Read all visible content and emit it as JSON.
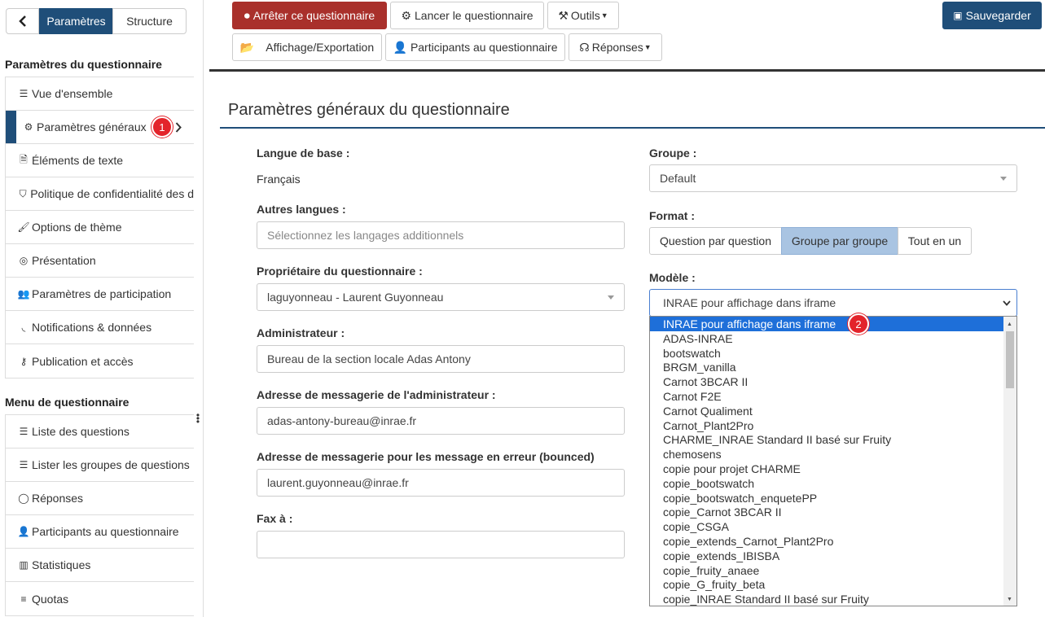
{
  "sidebar": {
    "tabs": {
      "params": "Paramètres",
      "structure": "Structure"
    },
    "section1_title": "Paramètres du questionnaire",
    "section1_items": [
      {
        "icon": "list-icon",
        "label": "Vue d'ensemble"
      },
      {
        "icon": "gears-icon",
        "label": "Paramètres généraux",
        "badge": "1"
      },
      {
        "icon": "file-text-icon",
        "label": "Éléments de texte"
      },
      {
        "icon": "shield-icon",
        "label": "Politique de confidentialité des d"
      },
      {
        "icon": "brush-icon",
        "label": "Options de thème"
      },
      {
        "icon": "eye-slash-icon",
        "label": "Présentation"
      },
      {
        "icon": "users-icon",
        "label": "Paramètres de participation"
      },
      {
        "icon": "rss-icon",
        "label": "Notifications & données"
      },
      {
        "icon": "key-icon",
        "label": "Publication et accès"
      }
    ],
    "section2_title": "Menu de questionnaire",
    "section2_items": [
      {
        "icon": "list-icon",
        "label": "Liste des questions"
      },
      {
        "icon": "list-icon",
        "label": "Lister les groupes de questions"
      },
      {
        "icon": "comment-icon",
        "label": "Réponses"
      },
      {
        "icon": "user-icon",
        "label": "Participants au questionnaire"
      },
      {
        "icon": "bar-chart-icon",
        "label": "Statistiques"
      },
      {
        "icon": "bars-icon",
        "label": "Quotas"
      }
    ]
  },
  "toolbar": {
    "stop": "Arrêter ce questionnaire",
    "launch": "Lancer le questionnaire",
    "tools": "Outils",
    "save": "Sauvegarder",
    "display_export": "Affichage/Exportation",
    "participants": "Participants au questionnaire",
    "responses": "Réponses"
  },
  "page_title": "Paramètres généraux du questionnaire",
  "form": {
    "base_lang_label": "Langue de base :",
    "base_lang_value": "Français",
    "other_langs_label": "Autres langues :",
    "other_langs_placeholder": "Sélectionnez les langages additionnels",
    "owner_label": "Propriétaire du questionnaire :",
    "owner_value": "laguyonneau - Laurent Guyonneau",
    "admin_label": "Administrateur :",
    "admin_value": "Bureau de la section locale Adas Antony",
    "admin_email_label": "Adresse de messagerie de l'administrateur :",
    "admin_email_value": "adas-antony-bureau@inrae.fr",
    "bounce_email_label": "Adresse de messagerie pour les message en erreur (bounced)",
    "bounce_email_value": "laurent.guyonneau@inrae.fr",
    "fax_label": "Fax à :",
    "fax_value": "",
    "group_label": "Groupe :",
    "group_value": "Default",
    "format_label": "Format :",
    "format_options": [
      "Question par question",
      "Groupe par groupe",
      "Tout en un"
    ],
    "format_selected": "Groupe par groupe",
    "template_label": "Modèle :",
    "template_value": "INRAE pour affichage dans iframe",
    "template_badge": "2",
    "template_options": [
      "INRAE pour affichage dans iframe",
      "ADAS-INRAE",
      "bootswatch",
      "BRGM_vanilla",
      "Carnot 3BCAR II",
      "Carnot F2E",
      "Carnot Qualiment",
      "Carnot_Plant2Pro",
      "CHARME_INRAE Standard II basé sur Fruity",
      "chemosens",
      "copie pour projet CHARME",
      "copie_bootswatch",
      "copie_bootswatch_enquetePP",
      "copie_Carnot 3BCAR II",
      "copie_CSGA",
      "copie_extends_Carnot_Plant2Pro",
      "copie_extends_IBISBA",
      "copie_fruity_anaee",
      "copie_G_fruity_beta",
      "copie_INRAE Standard II basé sur Fruity"
    ]
  },
  "colors": {
    "primary": "#1f4e79",
    "danger": "#a9302b",
    "badge": "#e3242b",
    "highlight": "#1e6fd9"
  }
}
